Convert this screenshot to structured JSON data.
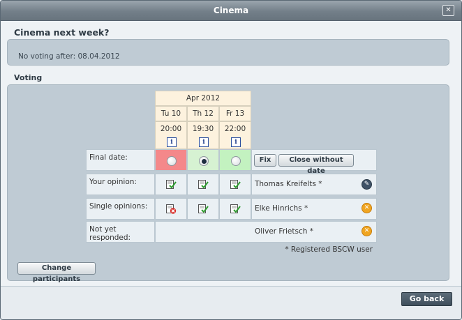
{
  "window": {
    "title": "Cinema",
    "close_label": "✕"
  },
  "poll": {
    "title": "Cinema next week?",
    "deadline": "No voting after: 08.04.2012"
  },
  "voting": {
    "section_label": "Voting",
    "month": "Apr 2012",
    "dates": [
      {
        "day": "Tu 10",
        "time": "20:00"
      },
      {
        "day": "Th 12",
        "time": "19:30"
      },
      {
        "day": "Fr 13",
        "time": "22:00"
      }
    ],
    "info_glyph": "i",
    "rows": {
      "final_date": "Final date:",
      "your_opinion": "Your opinion:",
      "single_opinions": "Single opinions:",
      "not_yet_responded": "Not yet responded:"
    },
    "final_date_colors": [
      "#f4888a",
      "#d6f2d2",
      "#c3f2c0"
    ],
    "selected_final_index": 1,
    "buttons": {
      "fix": "Fix",
      "close_without_date": "Close without date"
    },
    "your_opinion": {
      "person": "Thomas Kreifelts *",
      "votes": [
        "yes",
        "yes",
        "yes"
      ]
    },
    "single_opinions": [
      {
        "person": "Elke Hinrichs *",
        "votes": [
          "no",
          "yes",
          "yes"
        ]
      }
    ],
    "pending": [
      {
        "person": "Oliver Frietsch *"
      }
    ],
    "note": "* Registered BSCW user",
    "change_participants": "Change participants"
  },
  "footer": {
    "go_back": "Go back"
  },
  "colors": {
    "titlebar": "#737f89",
    "panel": "#bfcbd4",
    "accent_dark": "#3f4f5c",
    "remove": "#f0a521"
  }
}
